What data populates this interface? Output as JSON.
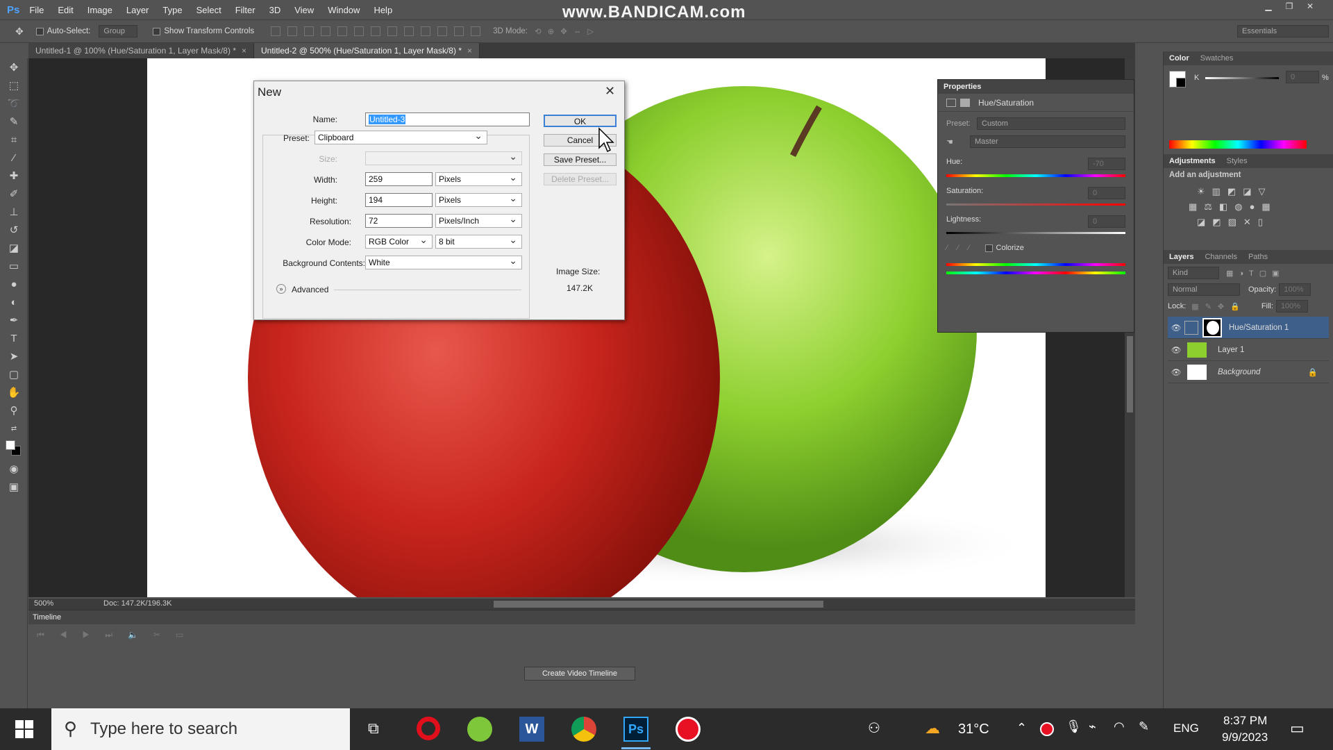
{
  "menubar": {
    "logo": "Ps",
    "items": [
      "File",
      "Edit",
      "Image",
      "Layer",
      "Type",
      "Select",
      "Filter",
      "3D",
      "View",
      "Window",
      "Help"
    ],
    "watermark": "www.BANDICAM.com"
  },
  "options": {
    "auto_select_label": "Auto-Select:",
    "group_value": "Group",
    "transform_label": "Show Transform Controls",
    "mode_3d_label": "3D Mode:",
    "workspace_value": "Essentials"
  },
  "tabs": [
    {
      "label": "Untitled-1 @ 100% (Hue/Saturation 1, Layer Mask/8) *",
      "close": "×"
    },
    {
      "label": "Untitled-2 @ 500% (Hue/Saturation 1, Layer Mask/8) *",
      "close": "×"
    }
  ],
  "status": {
    "zoom": "500%",
    "doc": "Doc: 147.2K/196.3K"
  },
  "timeline": {
    "title": "Timeline",
    "create_button": "Create Video Timeline"
  },
  "dialog": {
    "title": "New",
    "close": "✕",
    "name_label": "Name:",
    "name_value": "Untitled-3",
    "preset_label": "Preset:",
    "preset_value": "Clipboard",
    "size_label": "Size:",
    "width_label": "Width:",
    "width_value": "259",
    "width_unit": "Pixels",
    "height_label": "Height:",
    "height_value": "194",
    "height_unit": "Pixels",
    "resolution_label": "Resolution:",
    "resolution_value": "72",
    "resolution_unit": "Pixels/Inch",
    "color_mode_label": "Color Mode:",
    "color_mode_value": "RGB Color",
    "bit_depth_value": "8 bit",
    "background_label": "Background Contents:",
    "background_value": "White",
    "advanced_label": "Advanced",
    "ok_label": "OK",
    "cancel_label": "Cancel",
    "save_preset_label": "Save Preset...",
    "delete_preset_label": "Delete Preset...",
    "image_size_label": "Image Size:",
    "image_size_value": "147.2K"
  },
  "color_panel": {
    "tabs": [
      "Color",
      "Swatches"
    ],
    "k_label": "K",
    "k_value": "0",
    "percent": "%"
  },
  "adjustments_panel": {
    "tabs": [
      "Adjustments",
      "Styles"
    ],
    "add_label": "Add an adjustment"
  },
  "properties_panel": {
    "title": "Properties",
    "type_label": "Hue/Saturation",
    "preset_label": "Preset:",
    "preset_value": "Custom",
    "channel_value": "Master",
    "hue_label": "Hue:",
    "hue_value": "-70",
    "saturation_label": "Saturation:",
    "saturation_value": "0",
    "lightness_label": "Lightness:",
    "lightness_value": "0",
    "colorize_label": "Colorize"
  },
  "layers_panel": {
    "tabs": [
      "Layers",
      "Channels",
      "Paths"
    ],
    "kind_value": "Kind",
    "blend_value": "Normal",
    "opacity_label": "Opacity:",
    "opacity_value": "100%",
    "lock_label": "Lock:",
    "fill_label": "Fill:",
    "fill_value": "100%",
    "layers": [
      {
        "name": "Hue/Saturation 1",
        "selected": true
      },
      {
        "name": "Layer 1",
        "selected": false
      },
      {
        "name": "Background",
        "selected": false
      }
    ]
  },
  "taskbar": {
    "search_placeholder": "Type here to search",
    "weather": "31°C",
    "language": "ENG",
    "time": "8:37 PM",
    "date": "9/9/2023"
  },
  "colors": {
    "ui_dark": "#535353",
    "selection_blue": "#3e5f8a",
    "apple_red": "#c8251c",
    "apple_green": "#8ccf2e"
  }
}
